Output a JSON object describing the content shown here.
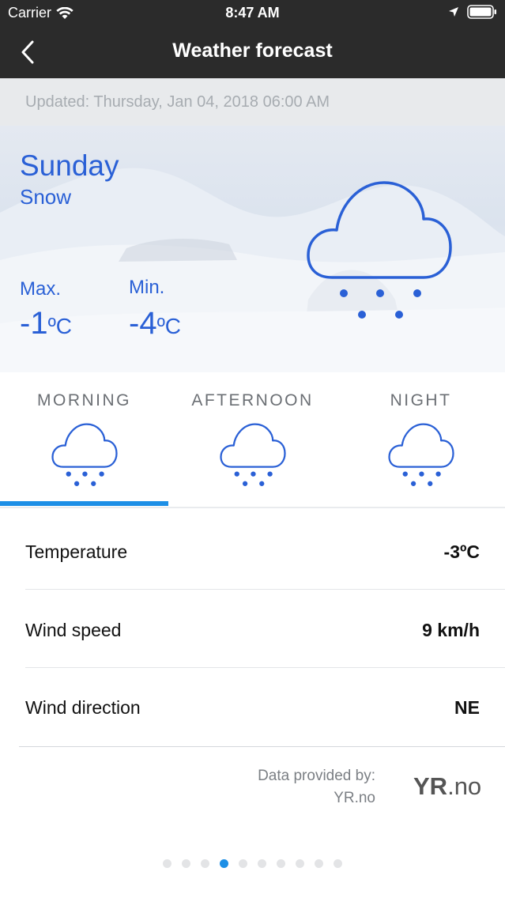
{
  "status_bar": {
    "carrier": "Carrier",
    "time": "8:47 AM"
  },
  "nav": {
    "title": "Weather forecast",
    "back_icon": "chevron-left-icon"
  },
  "updated": "Updated: Thursday, Jan 04, 2018 06:00 AM",
  "hero": {
    "day": "Sunday",
    "condition": "Snow",
    "max_label": "Max.",
    "min_label": "Min.",
    "max_value": "-1",
    "min_value": "-4",
    "unit": "ºC",
    "icon": "snow-cloud-icon"
  },
  "tabs": [
    {
      "label": "MORNING",
      "icon": "snow-cloud-icon",
      "selected": true
    },
    {
      "label": "AFTERNOON",
      "icon": "snow-cloud-icon",
      "selected": false
    },
    {
      "label": "NIGHT",
      "icon": "snow-cloud-icon",
      "selected": false
    }
  ],
  "details": [
    {
      "label": "Temperature",
      "value": "-3ºC"
    },
    {
      "label": "Wind speed",
      "value": "9 km/h"
    },
    {
      "label": "Wind direction",
      "value": "NE"
    }
  ],
  "credit": {
    "line1": "Data provided by:",
    "line2": "YR.no",
    "logo_bold": "YR",
    "logo_light": ".no"
  },
  "pager": {
    "count": 10,
    "active_index": 3
  },
  "colors": {
    "accent": "#2a60d6",
    "indicator": "#1d8fe6",
    "nav_bg": "#2b2b2b"
  }
}
